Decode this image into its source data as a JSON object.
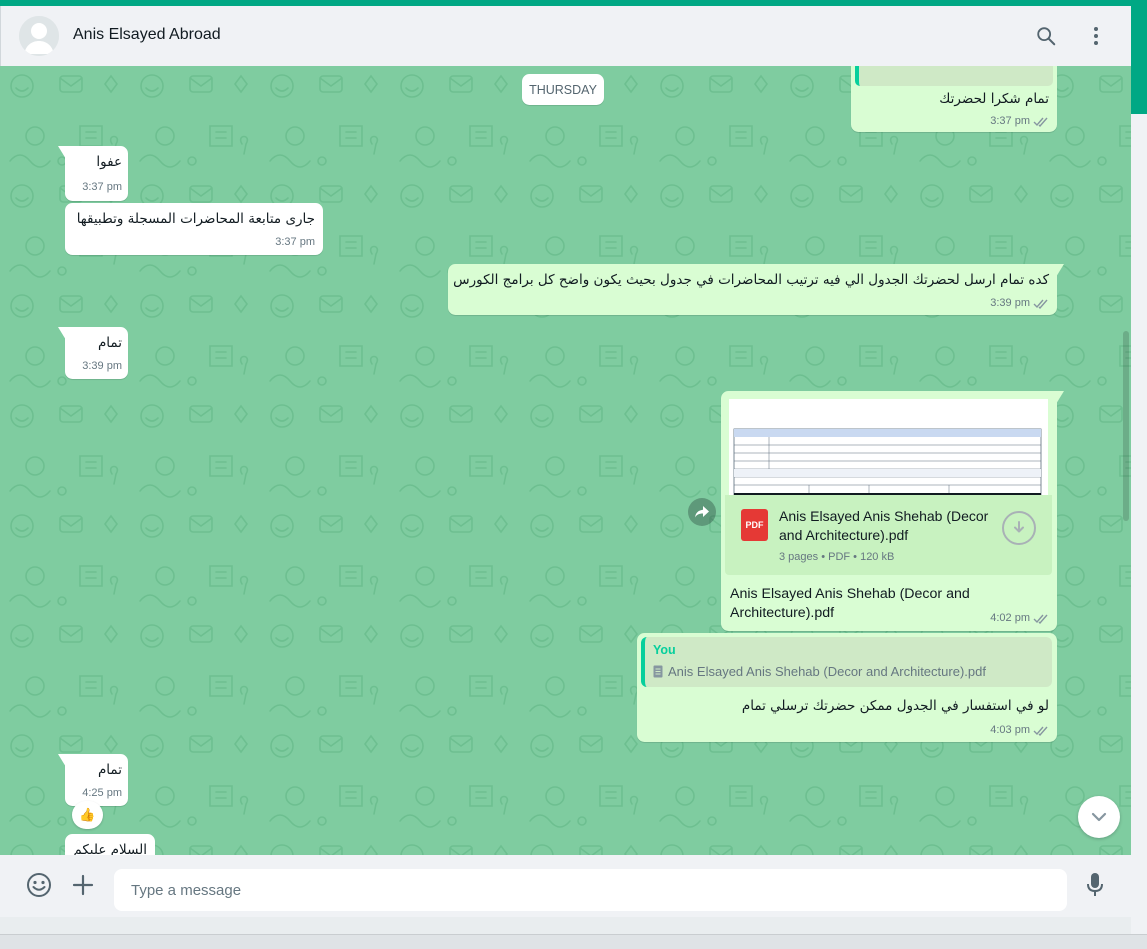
{
  "header": {
    "contact_name": "Anis Elsayed Abroad",
    "icons": [
      "default-avatar-icon",
      "search-icon",
      "menu-icon"
    ]
  },
  "chat": {
    "day_label": "THURSDAY",
    "messages": [
      {
        "dir": "out",
        "text": "تمام شكرا لحضرتك",
        "time": "3:37 pm",
        "status": "read"
      },
      {
        "dir": "in",
        "text": "عفوا",
        "time": "3:37 pm"
      },
      {
        "dir": "in",
        "text": "جارى متابعة المحاضرات المسجلة وتطبيقها",
        "time": "3:37 pm"
      },
      {
        "dir": "out",
        "text": "كده تمام ارسل لحضرتك الجدول الي فيه ترتيب المحاضرات في جدول بحيث يكون واضح كل برامج الكورس",
        "time": "3:39 pm",
        "status": "read"
      },
      {
        "dir": "in",
        "text": "تمام",
        "time": "3:39 pm"
      },
      {
        "dir": "out",
        "type": "document",
        "file_name": "Anis Elsayed Anis Shehab (Decor and Architecture).pdf",
        "file_type": "PDF",
        "file_info": "3 pages • PDF • 120 kB",
        "caption": "Anis Elsayed Anis Shehab (Decor and Architecture).pdf",
        "time": "4:02 pm",
        "status": "read"
      },
      {
        "dir": "out",
        "quote_author": "You",
        "quote_text": "Anis Elsayed Anis Shehab (Decor and Architecture).pdf",
        "text": "لو في استفسار في الجدول ممكن حضرتك ترسلي تمام",
        "time": "4:03 pm",
        "status": "read"
      },
      {
        "dir": "in",
        "text": "تمام",
        "time": "4:25 pm",
        "reaction": "👍"
      },
      {
        "dir": "in",
        "text": "السلام عليكم"
      }
    ]
  },
  "composer": {
    "placeholder": "Type a message",
    "icons": [
      "emoji-icon",
      "attach-plus-icon",
      "microphone-icon"
    ]
  },
  "colors": {
    "chat_background": "#7fcca0",
    "incoming_bubble": "#ffffff",
    "outgoing_bubble": "#d9fdd3",
    "accent": "#00a884",
    "read_tick": "#53bdeb"
  }
}
